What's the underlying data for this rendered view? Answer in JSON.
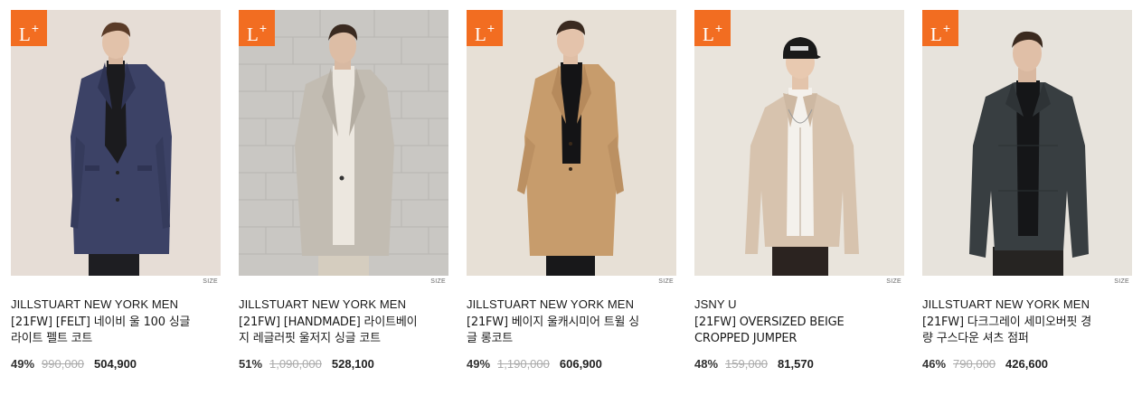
{
  "badge": {
    "text": "L",
    "sup": "+"
  },
  "size_label": "SIZE",
  "products": [
    {
      "brand": "JILLSTUART NEW YORK MEN",
      "title_line1": "[21FW] [FELT] 네이비 울 100 싱글",
      "title_line2": "라이트 펠트 코트",
      "discount": "49%",
      "original_price": "990,000",
      "sale_price": "504,900",
      "colors": {
        "bg": "#e6ddd6",
        "garment": "#3c4266",
        "inner": "#1b1b1e",
        "legs": "#1e1e22"
      }
    },
    {
      "brand": "JILLSTUART NEW YORK MEN",
      "title_line1": "[21FW] [HANDMADE] 라이트베이",
      "title_line2": "지 레글러핏 울저지 싱글 코트",
      "discount": "51%",
      "original_price": "1,090,000",
      "sale_price": "528,100",
      "colors": {
        "bg": "#c9c7c3",
        "garment": "#c2bcb2",
        "inner": "#ece7df",
        "legs": "#d5cdbf"
      }
    },
    {
      "brand": "JILLSTUART NEW YORK MEN",
      "title_line1": "[21FW] 베이지 울캐시미어 트윌 싱",
      "title_line2": "글 롱코트",
      "discount": "49%",
      "original_price": "1,190,000",
      "sale_price": "606,900",
      "colors": {
        "bg": "#e7e0d6",
        "garment": "#c79c6c",
        "inner": "#141416",
        "legs": "#18181a"
      }
    },
    {
      "brand": "JSNY U",
      "title_line1": "[21FW] OVERSIZED BEIGE",
      "title_line2": "CROPPED JUMPER",
      "discount": "48%",
      "original_price": "159,000",
      "sale_price": "81,570",
      "colors": {
        "bg": "#e9e4dc",
        "garment": "#d7c3ae",
        "inner": "#f4f1ec",
        "legs": "#2b2320"
      }
    },
    {
      "brand": "JILLSTUART NEW YORK MEN",
      "title_line1": "[21FW] 다크그레이 세미오버핏 경",
      "title_line2": "량 구스다운 셔츠 점퍼",
      "discount": "46%",
      "original_price": "790,000",
      "sale_price": "426,600",
      "colors": {
        "bg": "#e7e3dc",
        "garment": "#383e41",
        "inner": "#151618",
        "legs": "#262422"
      }
    }
  ]
}
